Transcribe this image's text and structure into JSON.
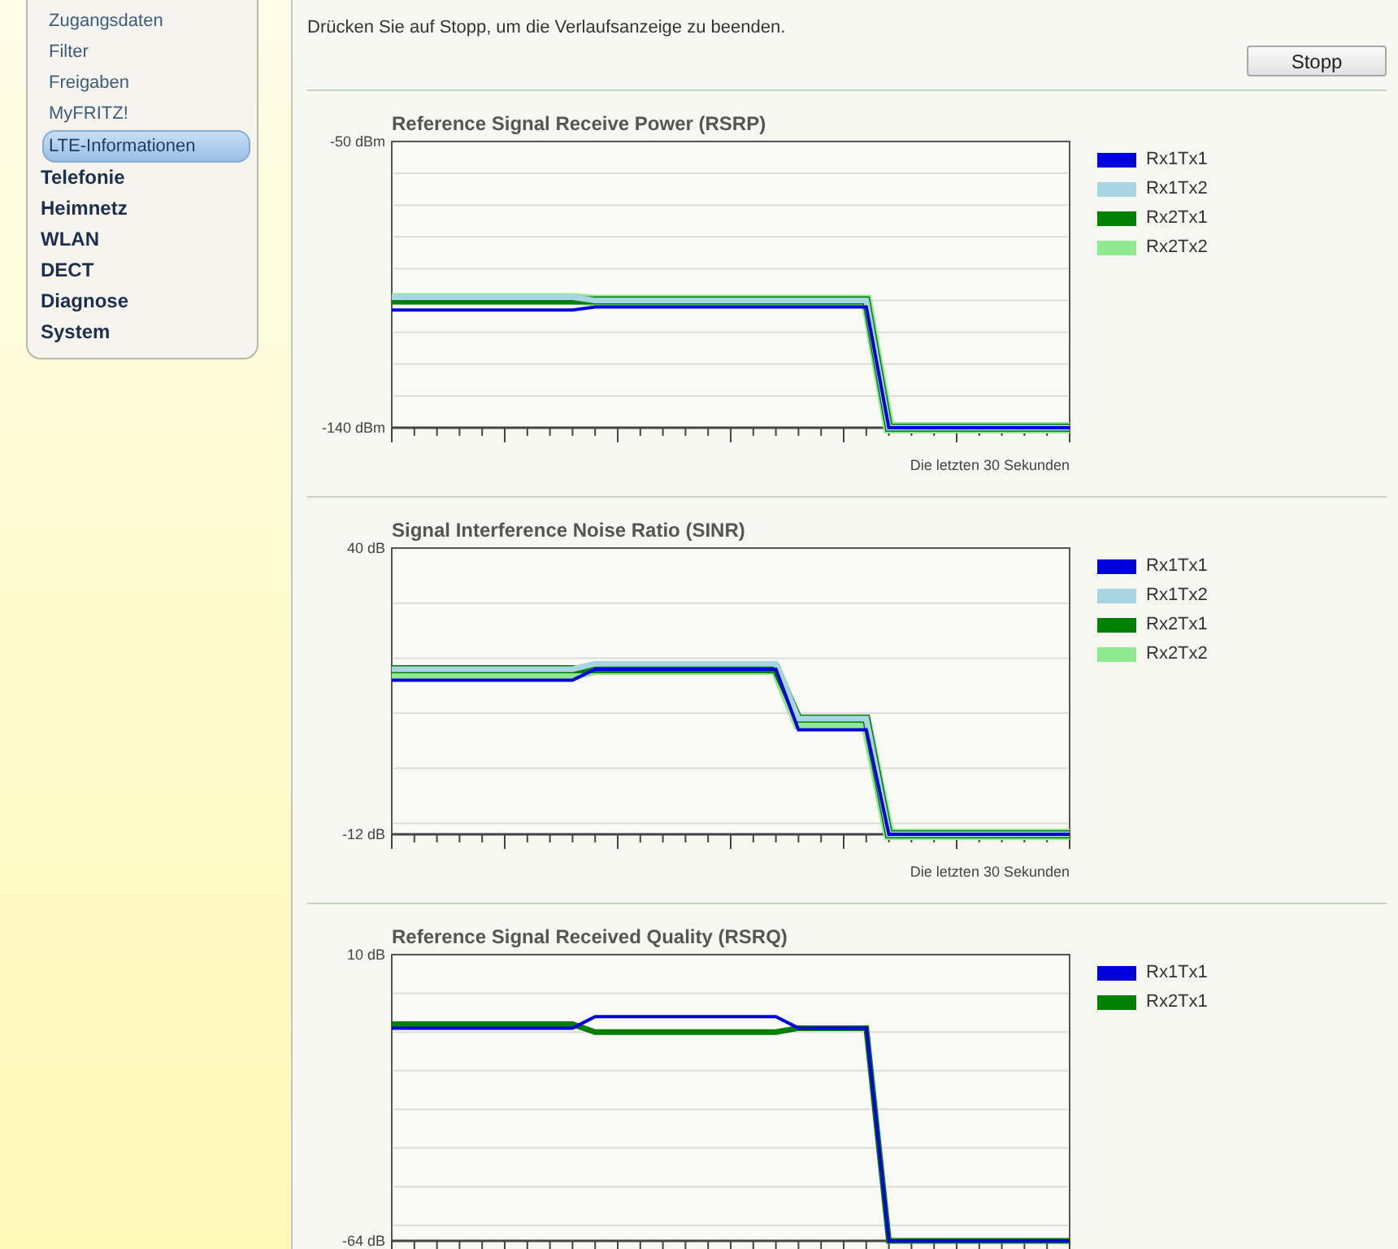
{
  "sidebar": {
    "subitems": [
      {
        "label": "Zugangsdaten",
        "selected": false
      },
      {
        "label": "Filter",
        "selected": false
      },
      {
        "label": "Freigaben",
        "selected": false
      },
      {
        "label": "MyFRITZ!",
        "selected": false
      },
      {
        "label": "LTE-Informationen",
        "selected": true
      }
    ],
    "items": [
      {
        "label": "Telefonie",
        "selected": false
      },
      {
        "label": "Heimnetz",
        "selected": false
      },
      {
        "label": "WLAN",
        "selected": false
      },
      {
        "label": "DECT",
        "selected": false
      },
      {
        "label": "Diagnose",
        "selected": false
      },
      {
        "label": "System",
        "selected": false
      }
    ]
  },
  "main": {
    "instruction": "Drücken Sie auf Stopp, um die Verlaufsanzeige zu beenden.",
    "stop_button": "Stopp",
    "charts": [
      {
        "chart_data": {
          "type": "line",
          "title": "Reference Signal Receive Power (RSRP)",
          "xlabel": "Die letzten 30 Sekunden",
          "ylim": [
            -140,
            -50
          ],
          "yticks": [
            {
              "value": -140,
              "label": "-140 dBm"
            },
            {
              "value": -50,
              "label": "-50 dBm"
            }
          ],
          "series": [
            {
              "name": "Rx1Tx1",
              "color": "#0000dd",
              "values": [
                -103,
                -103,
                -103,
                -103,
                -103,
                -103,
                -103,
                -103,
                -103,
                -102,
                -102,
                -102,
                -102,
                -102,
                -102,
                -102,
                -102,
                -102,
                -102,
                -102,
                -102,
                -102,
                -140,
                -140,
                -140,
                -140,
                -140,
                -140,
                -140,
                -140,
                -140
              ]
            },
            {
              "name": "Rx1Tx2",
              "color": "#a8d4e4",
              "values": [
                -99,
                -99,
                -99,
                -99,
                -99,
                -99,
                -99,
                -99,
                -99,
                -100,
                -100,
                -100,
                -100,
                -100,
                -100,
                -100,
                -100,
                -100,
                -100,
                -100,
                -100,
                -100,
                -140,
                -140,
                -140,
                -140,
                -140,
                -140,
                -140,
                -140,
                -140
              ]
            },
            {
              "name": "Rx2Tx1",
              "color": "#008000",
              "values": [
                -100,
                -100,
                -100,
                -100,
                -100,
                -100,
                -100,
                -100,
                -100,
                -100,
                -100,
                -100,
                -100,
                -100,
                -100,
                -100,
                -100,
                -100,
                -100,
                -100,
                -100,
                -100,
                -140,
                -140,
                -140,
                -140,
                -140,
                -140,
                -140,
                -140,
                -140
              ]
            },
            {
              "name": "Rx2Tx2",
              "color": "#90e890",
              "values": [
                -99.5,
                -99.5,
                -99.5,
                -99.5,
                -99.5,
                -99.5,
                -99.5,
                -99.5,
                -99.5,
                -100,
                -100,
                -100,
                -100,
                -100,
                -100,
                -100,
                -100,
                -100,
                -100,
                -100,
                -100,
                -100,
                -140,
                -140,
                -140,
                -140,
                -140,
                -140,
                -140,
                -140,
                -140
              ]
            }
          ]
        }
      },
      {
        "chart_data": {
          "type": "line",
          "title": "Signal Interference Noise Ratio (SINR)",
          "xlabel": "Die letzten 30 Sekunden",
          "ylim": [
            -12,
            40
          ],
          "yticks": [
            {
              "value": -12,
              "label": "-12 dB"
            },
            {
              "value": 40,
              "label": "40 dB"
            }
          ],
          "series": [
            {
              "name": "Rx1Tx1",
              "color": "#0000dd",
              "values": [
                16,
                16,
                16,
                16,
                16,
                16,
                16,
                16,
                16,
                18,
                18,
                18,
                18,
                18,
                18,
                18,
                18,
                18,
                7,
                7,
                7,
                7,
                -12,
                -12,
                -12,
                -12,
                -12,
                -12,
                -12,
                -12,
                -12
              ]
            },
            {
              "name": "Rx1Tx2",
              "color": "#a8d4e4",
              "values": [
                18,
                18,
                18,
                18,
                18,
                18,
                18,
                18,
                18,
                19,
                19,
                19,
                19,
                19,
                19,
                19,
                19,
                19,
                9,
                9,
                9,
                9,
                -12,
                -12,
                -12,
                -12,
                -12,
                -12,
                -12,
                -12,
                -12
              ]
            },
            {
              "name": "Rx2Tx1",
              "color": "#008000",
              "values": [
                18,
                18,
                18,
                18,
                18,
                18,
                18,
                18,
                18,
                18,
                18,
                18,
                18,
                18,
                18,
                18,
                18,
                18,
                9,
                9,
                9,
                9,
                -12,
                -12,
                -12,
                -12,
                -12,
                -12,
                -12,
                -12,
                -12
              ]
            },
            {
              "name": "Rx2Tx2",
              "color": "#90e890",
              "values": [
                17,
                17,
                17,
                17,
                17,
                17,
                17,
                17,
                17,
                18,
                18,
                18,
                18,
                18,
                18,
                18,
                18,
                18,
                8,
                8,
                8,
                8,
                -12,
                -12,
                -12,
                -12,
                -12,
                -12,
                -12,
                -12,
                -12
              ]
            }
          ]
        }
      },
      {
        "chart_data": {
          "type": "line",
          "title": "Reference Signal Received Quality (RSRQ)",
          "ylim": [
            -64,
            10
          ],
          "yticks": [
            {
              "value": -64,
              "label": "-64 dB"
            },
            {
              "value": 10,
              "label": "10 dB"
            }
          ],
          "series": [
            {
              "name": "Rx1Tx1",
              "color": "#0000dd",
              "values": [
                -9,
                -9,
                -9,
                -9,
                -9,
                -9,
                -9,
                -9,
                -9,
                -6,
                -6,
                -6,
                -6,
                -6,
                -6,
                -6,
                -6,
                -6,
                -9,
                -9,
                -9,
                -9,
                -64,
                -64,
                -64,
                -64,
                -64,
                -64,
                -64,
                -64,
                -64
              ]
            },
            {
              "name": "Rx2Tx1",
              "color": "#008000",
              "values": [
                -8,
                -8,
                -8,
                -8,
                -8,
                -8,
                -8,
                -8,
                -8,
                -10,
                -10,
                -10,
                -10,
                -10,
                -10,
                -10,
                -10,
                -10,
                -9,
                -9,
                -9,
                -9,
                -64,
                -64,
                -64,
                -64,
                -64,
                -64,
                -64,
                -64,
                -64
              ]
            }
          ]
        }
      }
    ]
  }
}
